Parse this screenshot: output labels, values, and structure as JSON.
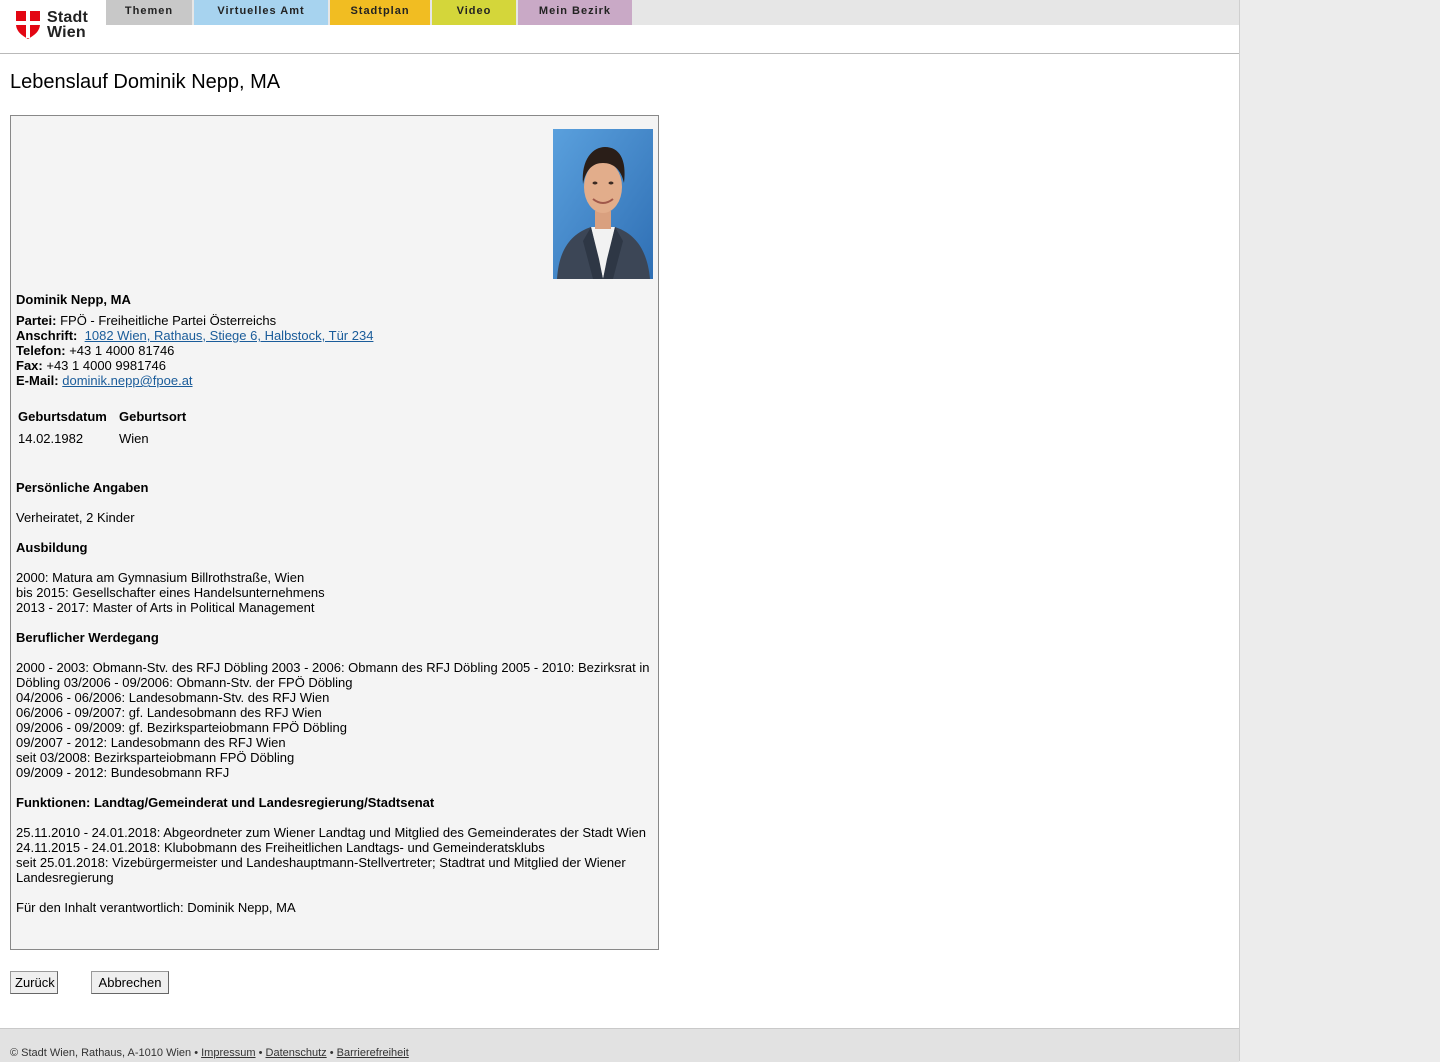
{
  "header": {
    "logo_line1": "Stadt",
    "logo_line2": "Wien",
    "tabs": [
      {
        "label": "Themen",
        "color": "#c8c8c8"
      },
      {
        "label": "Virtuelles Amt",
        "color": "#a7d3ef"
      },
      {
        "label": "Stadtplan",
        "color": "#f1bd22"
      },
      {
        "label": "Video",
        "color": "#d4d63a"
      },
      {
        "label": "Mein Bezirk",
        "color": "#c9a9c6"
      }
    ]
  },
  "page_title": "Lebenslauf Dominik Nepp, MA",
  "profile": {
    "name": "Dominik Nepp, MA",
    "party_label": "Partei:",
    "party": "FPÖ - Freiheitliche Partei Österreichs",
    "address_label": "Anschrift:",
    "address": "1082 Wien, Rathaus, Stiege 6, Halbstock, Tür 234",
    "phone_label": "Telefon:",
    "phone": "+43 1 4000 81746",
    "fax_label": "Fax:",
    "fax": "+43 1 4000 9981746",
    "email_label": "E-Mail:",
    "email": "dominik.nepp@fpoe.at"
  },
  "birth": {
    "headers": [
      "Geburtsdatum",
      "Geburtsort"
    ],
    "values": [
      "14.02.1982",
      "Wien"
    ]
  },
  "sections": {
    "personal_title": "Persönliche Angaben",
    "personal_text": "Verheiratet, 2 Kinder",
    "education_title": "Ausbildung",
    "education": [
      "2000: Matura am Gymnasium Billrothstraße, Wien",
      "bis 2015: Gesellschafter eines Handelsunternehmens",
      "2013 - 2017: Master of Arts in Political Management"
    ],
    "career_title": "Beruflicher Werdegang",
    "career": [
      "2000 - 2003: Obmann-Stv. des RFJ Döbling 2003 - 2006: Obmann des RFJ Döbling 2005 - 2010: Bezirksrat in",
      "Döbling 03/2006 - 09/2006: Obmann-Stv. der FPÖ Döbling",
      "04/2006 - 06/2006: Landesobmann-Stv. des RFJ Wien",
      "06/2006 - 09/2007: gf. Landesobmann des RFJ Wien",
      "09/2006 - 09/2009: gf. Bezirksparteiobmann FPÖ Döbling",
      "09/2007 - 2012: Landesobmann des RFJ Wien",
      "seit 03/2008: Bezirksparteiobmann FPÖ Döbling",
      "09/2009 - 2012: Bundesobmann RFJ"
    ],
    "functions_title": "Funktionen: Landtag/Gemeinderat und Landesregierung/Stadtsenat",
    "functions": [
      "25.11.2010 - 24.01.2018: Abgeordneter zum Wiener Landtag und Mitglied des Gemeinderates der Stadt Wien",
      "24.11.2015 - 24.01.2018: Klubobmann des Freiheitlichen Landtags- und Gemeinderatsklubs",
      "seit 25.01.2018: Vizebürgermeister und Landeshauptmann-Stellvertreter; Stadtrat und Mitglied der Wiener",
      "Landesregierung"
    ],
    "responsible": "Für den Inhalt verantwortlich: Dominik Nepp, MA"
  },
  "buttons": {
    "back": "Zurück",
    "cancel": "Abbrechen"
  },
  "footer": {
    "copyright": "© Stadt Wien, Rathaus, A-1010 Wien",
    "sep": "•",
    "links": [
      "Impressum",
      "Datenschutz",
      "Barrierefreiheit"
    ]
  }
}
